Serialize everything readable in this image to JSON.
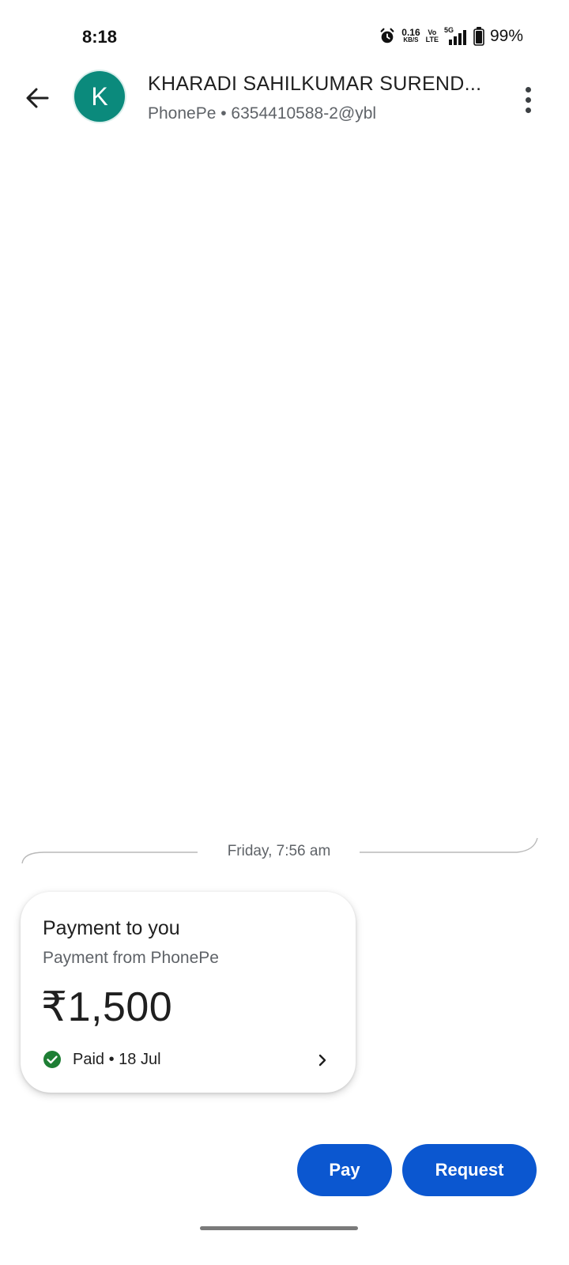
{
  "status_bar": {
    "time": "8:18",
    "net_speed_value": "0.16",
    "net_speed_unit": "KB/S",
    "volte_top": "Vo",
    "volte_bottom": "LTE",
    "network": "5G",
    "battery": "99%"
  },
  "header": {
    "avatar_letter": "K",
    "contact_name": "KHARADI SAHILKUMAR SUREND...",
    "contact_sub": "PhonePe • 6354410588-2@ybl"
  },
  "conversation": {
    "date_label": "Friday, 7:56 am",
    "payment_card": {
      "title": "Payment to you",
      "subtitle": "Payment from PhonePe",
      "amount": "₹1,500",
      "status": "Paid • 18 Jul"
    }
  },
  "actions": {
    "pay_label": "Pay",
    "request_label": "Request"
  },
  "colors": {
    "accent": "#0b57d0",
    "avatar_bg": "#0b8a7c",
    "success": "#1e7e34"
  },
  "icons": [
    "alarm-icon",
    "battery-icon",
    "back-arrow-icon",
    "more-vert-icon",
    "check-circle-icon",
    "chevron-right-icon"
  ]
}
